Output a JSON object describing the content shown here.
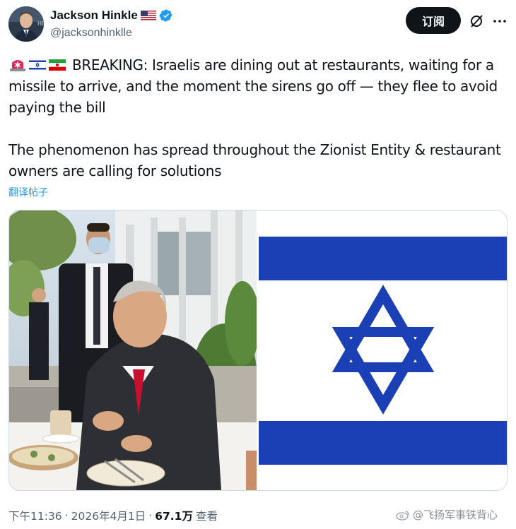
{
  "author": {
    "display_name": "Jackson Hinkle",
    "handle": "@jacksonhinklle",
    "flag_emoji": "us-flag",
    "verified": true
  },
  "actions": {
    "subscribe_label": "订阅",
    "grok_icon": "grok-slash-icon",
    "more_icon": "more-horizontal-icon"
  },
  "tweet": {
    "emojis": [
      "rotating-light-emoji",
      "israel-flag-emoji",
      "iran-flag-emoji"
    ],
    "line1": "BREAKING: Israelis are dining out at restaurants, waiting for a missile to arrive, and the moment the sirens go off — they flee to avoid paying the bill",
    "line2": "The phenomenon has spread throughout the Zionist Entity & restaurant owners are calling for solutions"
  },
  "translate_label": "翻译帖子",
  "media": {
    "images": [
      "restaurant-photo",
      "israel-flag-image"
    ]
  },
  "meta": {
    "time": "下午11:36",
    "separator1": "·",
    "date": "2026年4月1日",
    "separator2": "·",
    "views": "67.1万",
    "views_label": "查看"
  },
  "watermark": "@飞扬军事铁背心",
  "colors": {
    "accent": "#1d9bf0",
    "flag_blue": "#1b3fb5",
    "text": "#0f1419",
    "muted": "#536471"
  }
}
